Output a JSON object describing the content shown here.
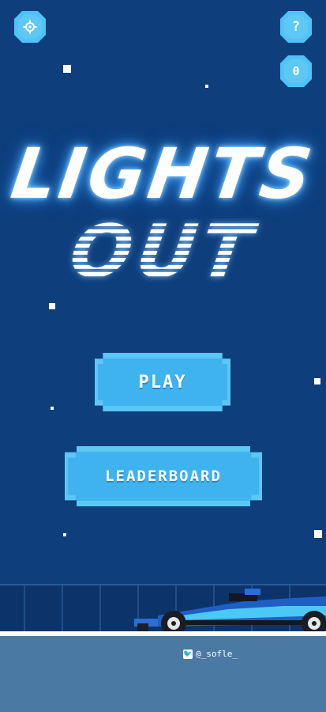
{
  "title": {
    "line1": "LIGHTS",
    "line2": "OUT"
  },
  "menu": {
    "play_label": "PLAY",
    "leaderboard_label": "LEADERBOARD"
  },
  "top_bar": {
    "help_label": "?",
    "coin_label": "0"
  },
  "footer": {
    "credit_handle": "@_sofle_"
  },
  "colors": {
    "background": "#0e3e7c",
    "button_fill": "#3fb3ee",
    "button_edge": "#5cc6f5",
    "ground": "#4a7aa3"
  },
  "icons": {
    "settings": "gear-icon",
    "help": "question-icon",
    "coin": "coin-icon",
    "twitter": "twitter-icon"
  }
}
